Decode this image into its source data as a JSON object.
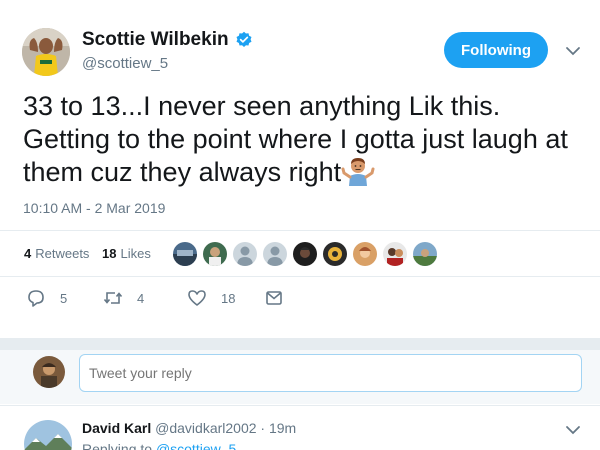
{
  "tweet": {
    "author": {
      "name": "Scottie Wilbekin",
      "handle": "@scottiew_5",
      "verified": true,
      "verified_icon": "verified-badge-icon"
    },
    "follow_button_label": "Following",
    "text": "33 to 13...I never seen anything Lik this. Getting to the point where I gotta just laugh at them cuz they always right",
    "emoji": "man-shrugging-emoji",
    "timestamp": "10:10 AM - 2 Mar 2019",
    "stats": {
      "retweets_count": "4",
      "retweets_label": "Retweets",
      "likes_count": "18",
      "likes_label": "Likes"
    },
    "likers": [
      "liker-1",
      "liker-2",
      "liker-3",
      "liker-4",
      "liker-5",
      "liker-6",
      "liker-7",
      "liker-8",
      "liker-9"
    ],
    "actions": {
      "replies": "5",
      "retweets": "4",
      "likes": "18"
    }
  },
  "reply_composer": {
    "placeholder": "Tweet your reply"
  },
  "reply": {
    "name": "David Karl",
    "handle": "@davidkarl2002",
    "time": "· 19m",
    "replying_label": "Replying to",
    "replying_to": "@scottiew_5"
  },
  "colors": {
    "accent": "#1da1f2",
    "text": "#14171a",
    "muted": "#657786",
    "divider": "#e6ecf0"
  }
}
